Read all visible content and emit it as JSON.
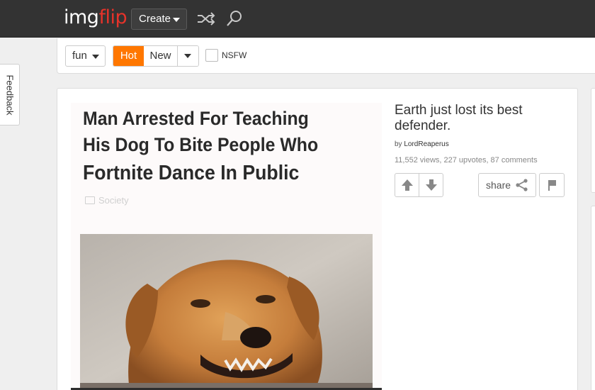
{
  "header": {
    "logo_part1": "img",
    "logo_part2": "flip",
    "create_label": "Create",
    "shuffle_icon": "shuffle-icon",
    "search_icon": "search-icon",
    "colors": {
      "bar": "#333333",
      "logo_accent": "#e6332a"
    }
  },
  "filters": {
    "stream_value": "fun",
    "sort_hot": "Hot",
    "sort_new": "New",
    "nsfw_label": "NSFW",
    "nsfw_checked": false,
    "active_color": "#ff7700"
  },
  "feedback_label": "Feedback",
  "post": {
    "meme": {
      "line1": "Man Arrested For Teaching",
      "line2": "His Dog To Bite People Who",
      "line3": "Fortnite Dance In Public",
      "category": "Society"
    },
    "title": "Earth just lost its best defender.",
    "by_prefix": "by",
    "author": "LordReaperus",
    "stats": "11,552 views, 227 upvotes, 87 comments",
    "share_label": "share",
    "upvote_icon": "arrow-up-icon",
    "downvote_icon": "arrow-down-icon",
    "flag_icon": "flag-icon"
  }
}
